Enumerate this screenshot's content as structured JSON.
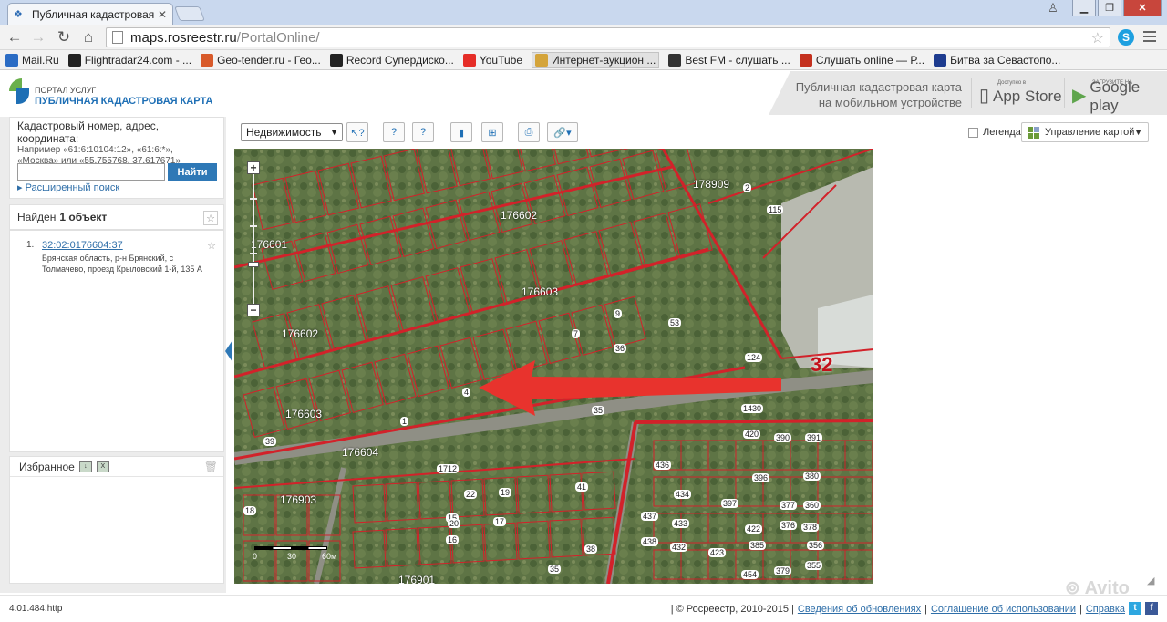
{
  "browser": {
    "tab_title": "Публичная кадастровая",
    "url_host": "maps.rosreestr.ru",
    "url_path": "/PortalOnline/",
    "bookmarks": [
      {
        "label": "Mail.Ru",
        "color": "#2b6cc4"
      },
      {
        "label": "Flightradar24.com - ...",
        "color": "#222222"
      },
      {
        "label": "Geo-tender.ru - Гео...",
        "color": "#d85a2a"
      },
      {
        "label": "Record Супердиско...",
        "color": "#222222"
      },
      {
        "label": "YouTube",
        "color": "#e52d27"
      },
      {
        "label": "Интернет-аукцион ...",
        "color": "#d4a43a"
      },
      {
        "label": "Best FM - слушать ...",
        "color": "#333333"
      },
      {
        "label": "Слушать online — Р...",
        "color": "#c4301e"
      },
      {
        "label": "Битва за Севастопо...",
        "color": "#1d3b8f"
      }
    ]
  },
  "portal": {
    "line1": "ПОРТАЛ УСЛУГ",
    "line2": "ПУБЛИЧНАЯ КАДАСТРОВАЯ КАРТА",
    "promo_line1": "Публичная кадастровая карта",
    "promo_line2": "на мобильном устройстве",
    "appstore_small": "Доступно в",
    "appstore_big": "App Store",
    "gplay_small": "ЗАГРУЗИТЕ НА",
    "gplay_big": "Google play"
  },
  "search": {
    "hint_title": "Кадастровый номер, адрес, координата:",
    "hint_examples_1": "Например «61:6:10104:12», «61:6:*»,",
    "hint_examples_2": "«Москва» или «55.755768, 37.617671»",
    "input_value": "",
    "button": "Найти",
    "advanced": "Расширенный поиск"
  },
  "results": {
    "found_prefix": "Найден",
    "found_count": "1 объект",
    "items": [
      {
        "index": "1.",
        "number": "32:02:0176604:37",
        "address_line1": "Брянская область, р-н Брянский, с",
        "address_line2": "Толмачево, проезд Крыловский 1-й, 135 А"
      }
    ]
  },
  "favorites": {
    "title": "Избранное"
  },
  "toolbar": {
    "layer_select": "Недвижимость",
    "legend": "Легенда",
    "map_manage": "Управление картой"
  },
  "map": {
    "scale_zero": "0",
    "scale_mid": "30",
    "scale_end": "60м",
    "quarters": [
      "176602",
      "176603",
      "176601",
      "176602",
      "176603",
      "176604",
      "176903",
      "176901",
      "178909"
    ],
    "region_label": "32",
    "plot_labels": [
      "2",
      "115",
      "124",
      "1430",
      "35",
      "39",
      "1712",
      "420",
      "390",
      "391",
      "436",
      "396",
      "380",
      "360",
      "378",
      "356",
      "355",
      "379",
      "454",
      "422",
      "433",
      "432",
      "397",
      "385",
      "377",
      "376",
      "437",
      "438",
      "434",
      "423",
      "16",
      "15",
      "17",
      "19",
      "20",
      "22",
      "41",
      "38",
      "35",
      "18",
      "1",
      "4",
      "7",
      "9",
      "53",
      "36"
    ]
  },
  "footer": {
    "version": "4.01.484.http",
    "copyright": "| © Росреестр, 2010-2015 |",
    "link_updates": "Сведения об обновлениях",
    "link_terms": "Соглашение об использовании",
    "link_help": "Справка"
  },
  "colors": {
    "accent": "#2e78b6",
    "parcel_border": "#d2222a",
    "arrow": "#e8332d"
  }
}
